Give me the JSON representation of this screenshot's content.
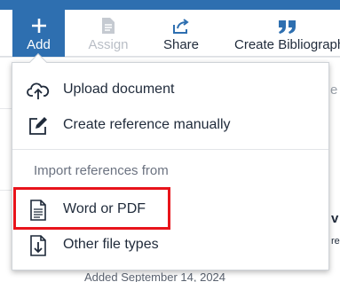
{
  "toolbar": {
    "add_label": "Add",
    "assign_label": "Assign",
    "share_label": "Share",
    "create_bibliography_label": "Create Bibliograph"
  },
  "menu": {
    "upload_label": "Upload document",
    "create_manual_label": "Create reference manually",
    "import_section_label": "Import references from",
    "word_pdf_label": "Word or PDF",
    "other_types_label": "Other file types"
  },
  "background": {
    "partial_date": "Added September 14, 2024"
  },
  "colors": {
    "brand_blue": "#2e6fb0",
    "highlight_red": "#e8141b"
  }
}
